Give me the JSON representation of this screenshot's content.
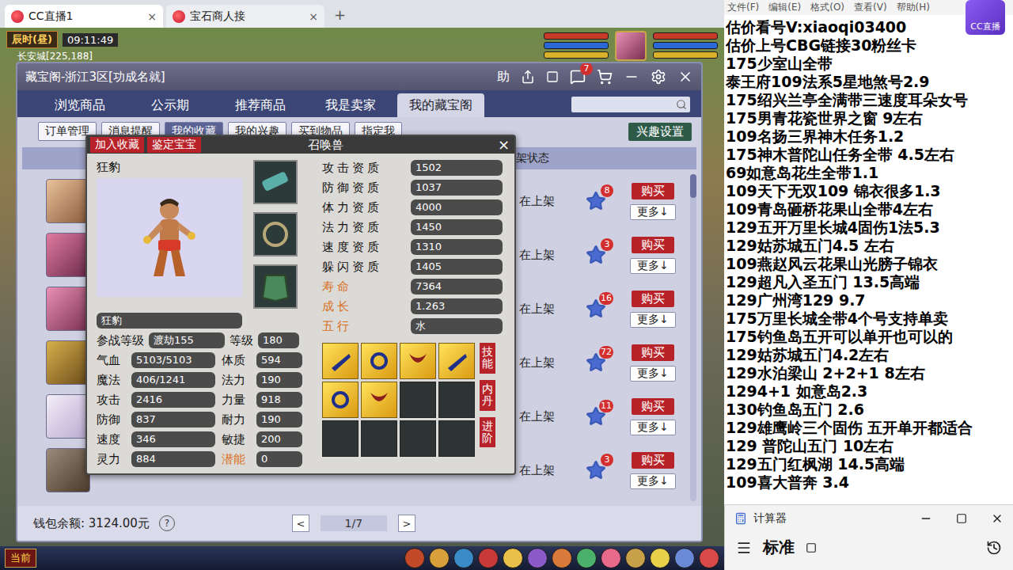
{
  "browser": {
    "tabs": [
      {
        "label": "CC直播1",
        "selected": true,
        "close": "×"
      },
      {
        "label": "宝石商人接",
        "selected": false,
        "close": "×"
      }
    ],
    "new_tab": "+"
  },
  "game_hud": {
    "time_label": "辰时(昼)",
    "clock": "09:11:49",
    "location": "长安城[225,188]"
  },
  "cbg_window": {
    "title": "藏宝阁-浙江3区[功成名就]",
    "help": "助",
    "chat_badge": "7",
    "tabs": [
      {
        "label": "浏览商品",
        "selected": false
      },
      {
        "label": "公示期",
        "selected": false
      },
      {
        "label": "推荐商品",
        "selected": false
      },
      {
        "label": "我是卖家",
        "selected": false
      },
      {
        "label": "我的藏宝阁",
        "selected": true
      }
    ],
    "subtabs": [
      {
        "label": "订单管理",
        "selected": false
      },
      {
        "label": "消息提醒",
        "selected": false
      },
      {
        "label": "我的收藏",
        "selected": true
      },
      {
        "label": "我的兴趣",
        "selected": false
      },
      {
        "label": "买到物品",
        "selected": false
      },
      {
        "label": "指定我",
        "selected": false
      }
    ],
    "interest_button": "兴趣设置",
    "column_header": "架状态",
    "rows": [
      {
        "status": "在上架",
        "favorites": "8",
        "buy": "购买",
        "more": "更多↓"
      },
      {
        "status": "在上架",
        "favorites": "3",
        "buy": "购买",
        "more": "更多↓"
      },
      {
        "status": "在上架",
        "favorites": "16",
        "buy": "购买",
        "more": "更多↓"
      },
      {
        "status": "在上架",
        "favorites": "72",
        "buy": "购买",
        "more": "更多↓"
      },
      {
        "status": "在上架",
        "favorites": "11",
        "buy": "购买",
        "more": "更多↓"
      },
      {
        "status": "在上架",
        "favorites": "3",
        "buy": "购买",
        "more": "更多↓"
      }
    ],
    "wallet": "钱包余额: 3124.00元",
    "help_mark": "?",
    "prev": "<",
    "page": "1/7",
    "next": ">"
  },
  "pet_popup": {
    "buttons": [
      "加入收藏",
      "鉴定宝宝"
    ],
    "title": "召唤兽",
    "close": "×",
    "name": "狂豹",
    "name_field": "狂豹",
    "battle_level_label": "参战等级",
    "battle_level": "渡劫155",
    "level_label": "等级",
    "level": "180",
    "stats": [
      {
        "label": "气血",
        "value": "5103/5103",
        "attr_label": "体质",
        "attr_value": "594",
        "attr_highlight": false
      },
      {
        "label": "魔法",
        "value": "406/1241",
        "attr_label": "法力",
        "attr_value": "190",
        "attr_highlight": false
      },
      {
        "label": "攻击",
        "value": "2416",
        "attr_label": "力量",
        "attr_value": "918",
        "attr_highlight": false
      },
      {
        "label": "防御",
        "value": "837",
        "attr_label": "耐力",
        "attr_value": "190",
        "attr_highlight": false
      },
      {
        "label": "速度",
        "value": "346",
        "attr_label": "敏捷",
        "attr_value": "200",
        "attr_highlight": false
      },
      {
        "label": "灵力",
        "value": "884",
        "attr_label": "潜能",
        "attr_value": "0",
        "attr_highlight": true
      }
    ],
    "aptitudes": [
      {
        "label": "攻击资质",
        "value": "1502",
        "highlight": false
      },
      {
        "label": "防御资质",
        "value": "1037",
        "highlight": false
      },
      {
        "label": "体力资质",
        "value": "4000",
        "highlight": false
      },
      {
        "label": "法力资质",
        "value": "1450",
        "highlight": false
      },
      {
        "label": "速度资质",
        "value": "1310",
        "highlight": false
      },
      {
        "label": "躲闪资质",
        "value": "1405",
        "highlight": false
      },
      {
        "label": "寿命",
        "value": "7364",
        "highlight": true
      },
      {
        "label": "成长",
        "value": "1.263",
        "highlight": true
      },
      {
        "label": "五行",
        "value": "水",
        "highlight": true
      }
    ],
    "skills": [
      {
        "filled": true
      },
      {
        "filled": true
      },
      {
        "filled": true
      },
      {
        "filled": true
      },
      {
        "filled": true
      },
      {
        "filled": true
      },
      {
        "filled": false
      },
      {
        "filled": false
      },
      {
        "filled": false
      },
      {
        "filled": false
      },
      {
        "filled": false
      },
      {
        "filled": false
      }
    ],
    "side_buttons": [
      "技能",
      "内丹",
      "进阶"
    ]
  },
  "bottom_bar": {
    "label": "当前"
  },
  "stream_logo": "CC直播",
  "notepad": {
    "menu": [
      "文件(F)",
      "编辑(E)",
      "格式(O)",
      "查看(V)",
      "帮助(H)"
    ],
    "lines": [
      "估价看号V:xiaoqi03400",
      "估价上号CBG链接30粉丝卡",
      "175少室山全带",
      "泰王府109法系5星地煞号2.9",
      "175绍兴兰亭全满带三速度耳朵女号",
      "175男青花瓷世界之窗  9左右",
      "109名扬三界神木任务1.2",
      "175神木普陀山任务全带 4.5左右",
      "69如意岛花生全带1.1",
      "109天下无双109  锦衣很多1.3",
      "109青岛砸桥花果山全带4左右",
      "129五开万里长城4固伤1法5.3",
      "129姑苏城五门4.5 左右",
      "109燕赵风云花果山光膀子锦衣",
      "129超凡入圣五门  13.5高端",
      "129广州湾129 9.7",
      "175万里长城全带4个号支持单卖",
      "175钓鱼岛五开可以单开也可以的",
      "129姑苏城五门4.2左右",
      "129水泊梁山 2+2+1 8左右",
      "1294+1 如意岛2.3",
      "130钓鱼岛五门   2.6",
      "129雄鹰岭三个固伤 五开单开都适合",
      "129 普陀山五门  10左右",
      "129五门红枫湖 14.5高端",
      "109喜大普奔  3.4"
    ]
  },
  "calculator": {
    "title": "计算器",
    "mode": "标准"
  }
}
